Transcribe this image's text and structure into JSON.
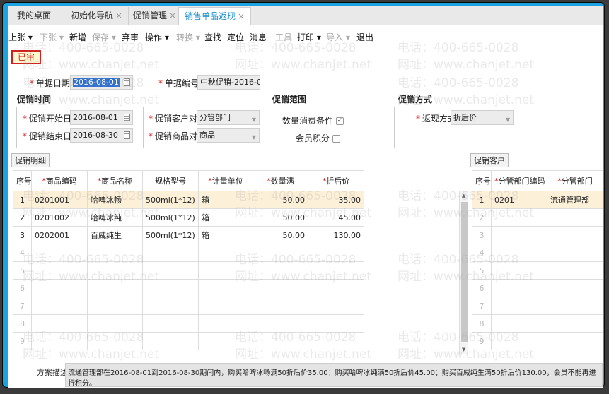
{
  "tabs": [
    {
      "label": "我的桌面",
      "closable": false
    },
    {
      "label": "初始化导航",
      "closable": true
    },
    {
      "label": "促销管理",
      "closable": true
    },
    {
      "label": "销售单品返现",
      "closable": true,
      "active": true
    }
  ],
  "toolbar": [
    {
      "label": "上张 ▾",
      "enabled": true
    },
    {
      "label": "下张 ▾",
      "enabled": false
    },
    {
      "label": "新增",
      "enabled": true
    },
    {
      "label": "保存 ▾",
      "enabled": false
    },
    {
      "label": "弃审",
      "enabled": true
    },
    {
      "label": "操作 ▾",
      "enabled": true
    },
    {
      "label": "转换 ▾",
      "enabled": false
    },
    {
      "label": "查找",
      "enabled": true
    },
    {
      "label": "定位",
      "enabled": true
    },
    {
      "label": "消息",
      "enabled": true
    },
    {
      "label": "工具",
      "enabled": false
    },
    {
      "label": "打印 ▾",
      "enabled": true
    },
    {
      "label": "导入 ▾",
      "enabled": false
    },
    {
      "label": "退出",
      "enabled": true
    }
  ],
  "status_badge": "已审",
  "form": {
    "doc_date_label": "单据日期",
    "doc_date": "2016-08-01",
    "doc_no_label": "单据编号",
    "doc_no": "中秋促销-2016-0...",
    "sec_time": "促销时间",
    "sec_scope": "促销范围",
    "sec_method": "促销方式",
    "start_label": "促销开始日期",
    "start": "2016-08-01",
    "end_label": "促销结束日期",
    "end": "2016-08-30",
    "cust_obj_label": "促销客户对象",
    "cust_obj": "分管部门",
    "goods_obj_label": "促销商品对象",
    "goods_obj": "商品",
    "qty_cond_label": "数量消费条件",
    "qty_cond_checked": true,
    "points_label": "会员积分",
    "points_checked": false,
    "rebate_label": "返现方式",
    "rebate": "折后价"
  },
  "detail": {
    "tab": "促销明细",
    "columns": [
      {
        "label": "序号",
        "req": false
      },
      {
        "label": "商品编码",
        "req": true
      },
      {
        "label": "商品名称",
        "req": true
      },
      {
        "label": "规格型号",
        "req": false
      },
      {
        "label": "计量单位",
        "req": true
      },
      {
        "label": "数量满",
        "req": true
      },
      {
        "label": "折后价",
        "req": true
      }
    ],
    "rows": [
      [
        "1",
        "0201001",
        "哈啤冰畅",
        "500ml(1*12)",
        "箱",
        "50.00",
        "35.00"
      ],
      [
        "2",
        "0201002",
        "哈啤冰纯",
        "500ml(1*12)",
        "箱",
        "50.00",
        "45.00"
      ],
      [
        "3",
        "0202001",
        "百威纯生",
        "500ml(1*12)",
        "箱",
        "50.00",
        "130.00"
      ]
    ],
    "empty_rows": [
      "4",
      "5",
      "6",
      "7",
      "8",
      "9"
    ]
  },
  "customers": {
    "tab": "促销客户",
    "columns": [
      {
        "label": "序号",
        "req": false
      },
      {
        "label": "分管部门编码",
        "req": true
      },
      {
        "label": "分管部门",
        "req": true
      }
    ],
    "rows": [
      [
        "1",
        "0201",
        "流通管理部"
      ]
    ],
    "empty_rows": [
      "2",
      "3",
      "4",
      "5",
      "6",
      "7",
      "8",
      "9"
    ]
  },
  "description_label": "方案描述",
  "description": "流通管理部在2016-08-01到2016-08-30期间内，购买哈啤冰畅满50折后价35.00；购买哈啤冰纯满50折后价45.00；购买百威纯生满50折后价130.00，会员不能再进行积分。",
  "watermark": {
    "phone": "电话：400-665-0028",
    "site": "网址：www.chanjet.net"
  }
}
